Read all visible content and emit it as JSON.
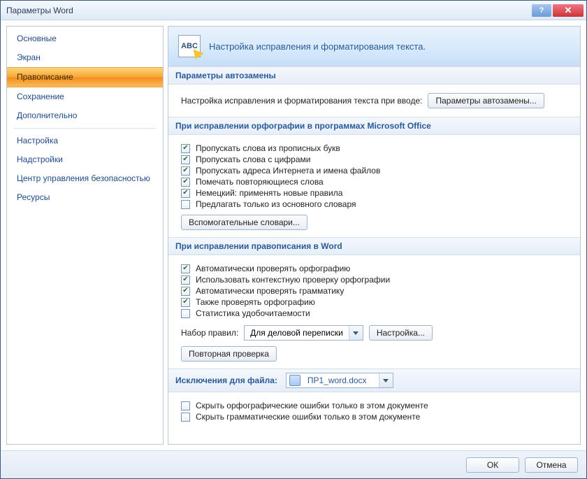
{
  "window": {
    "title": "Параметры Word"
  },
  "sidebar": {
    "items": [
      {
        "label": "Основные"
      },
      {
        "label": "Экран"
      },
      {
        "label": "Правописание",
        "selected": true
      },
      {
        "label": "Сохранение"
      },
      {
        "label": "Дополнительно"
      },
      {
        "label": "Настройка"
      },
      {
        "label": "Надстройки"
      },
      {
        "label": "Центр управления безопасностью"
      },
      {
        "label": "Ресурсы"
      }
    ]
  },
  "header": {
    "icon_label": "ABC",
    "text": "Настройка исправления и форматирования текста."
  },
  "sections": {
    "autocorrect": {
      "title": "Параметры автозамены",
      "desc": "Настройка исправления и форматирования текста при вводе:",
      "button": "Параметры автозамены..."
    },
    "office_spell": {
      "title": "При исправлении орфографии в программах Microsoft Office",
      "items": [
        {
          "label": "Пропускать слова из прописных букв",
          "checked": true
        },
        {
          "label": "Пропускать слова с цифрами",
          "checked": true
        },
        {
          "label": "Пропускать адреса Интернета и имена файлов",
          "checked": true
        },
        {
          "label": "Помечать повторяющиеся слова",
          "checked": true
        },
        {
          "label": "Немецкий: применять новые правила",
          "checked": true
        },
        {
          "label": "Предлагать только из основного словаря",
          "checked": false
        }
      ],
      "dict_button": "Вспомогательные словари..."
    },
    "word_spell": {
      "title": "При исправлении правописания в Word",
      "items": [
        {
          "label": "Автоматически проверять орфографию",
          "checked": true
        },
        {
          "label": "Использовать контекстную проверку орфографии",
          "checked": true
        },
        {
          "label": "Автоматически проверять грамматику",
          "checked": true
        },
        {
          "label": "Также проверять орфографию",
          "checked": true
        },
        {
          "label": "Статистика удобочитаемости",
          "checked": false
        }
      ],
      "ruleset_label": "Набор правил:",
      "ruleset_value": "Для деловой переписки",
      "ruleset_button": "Настройка...",
      "recheck_button": "Повторная проверка"
    },
    "exceptions": {
      "title": "Исключения для файла:",
      "file_value": "ПР1_word.docx",
      "items": [
        {
          "label": "Скрыть орфографические ошибки только в этом документе",
          "checked": false
        },
        {
          "label": "Скрыть грамматические ошибки только в этом документе",
          "checked": false
        }
      ]
    }
  },
  "footer": {
    "ok": "ОК",
    "cancel": "Отмена"
  }
}
